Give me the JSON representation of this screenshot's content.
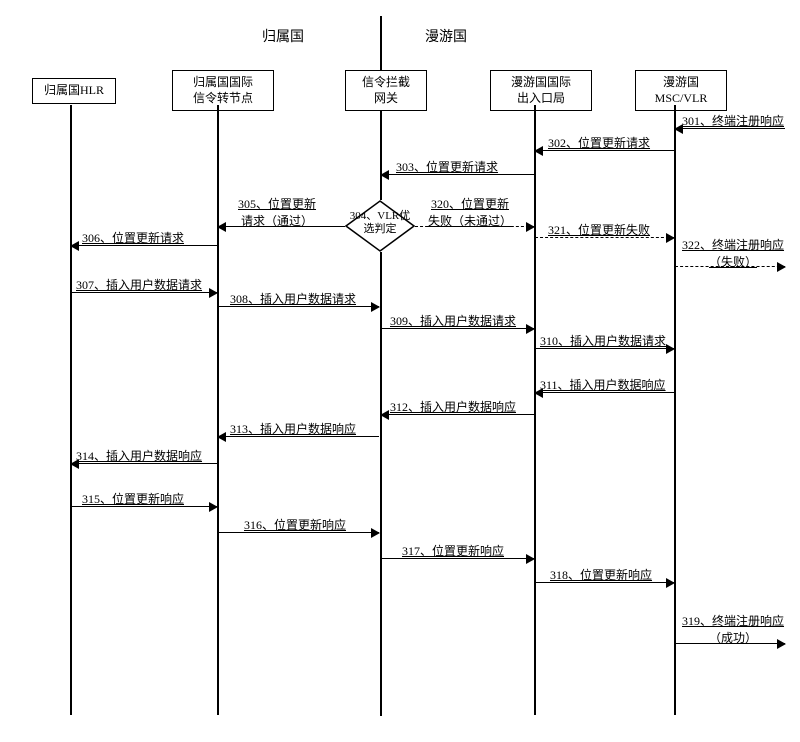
{
  "regions": {
    "home": "归属国",
    "roam": "漫游国"
  },
  "participants": {
    "p1": "归属国HLR",
    "p2": "归属国国际\n信令转节点",
    "p3": "信令拦截\n网关",
    "p4": "漫游国国际\n出入口局",
    "p5": "漫游国\nMSC/VLR"
  },
  "decision": "304、VLR优\n选判定",
  "messages": {
    "m301": "301、终端注册响应",
    "m302": "302、位置更新请求",
    "m303": "303、位置更新请求",
    "m305": "305、位置更新\n请求（通过）",
    "m306": "306、位置更新请求",
    "m307": "307、插入用户数据请求",
    "m308": "308、插入用户数据请求",
    "m309": "309、插入用户数据请求",
    "m310": "310、插入用户数据请求",
    "m311": "311、插入用户数据响应",
    "m312": "312、插入用户数据响应",
    "m313": "313、插入用户数据响应",
    "m314": "314、插入用户数据响应",
    "m315": "315、位置更新响应",
    "m316": "316、位置更新响应",
    "m317": "317、位置更新响应",
    "m318": "318、位置更新响应",
    "m319": "319、终端注册响应\n（成功）",
    "m320": "320、位置更新\n失败（未通过）",
    "m321": "321、位置更新失败",
    "m322": "322、终端注册响应\n（失败）"
  }
}
